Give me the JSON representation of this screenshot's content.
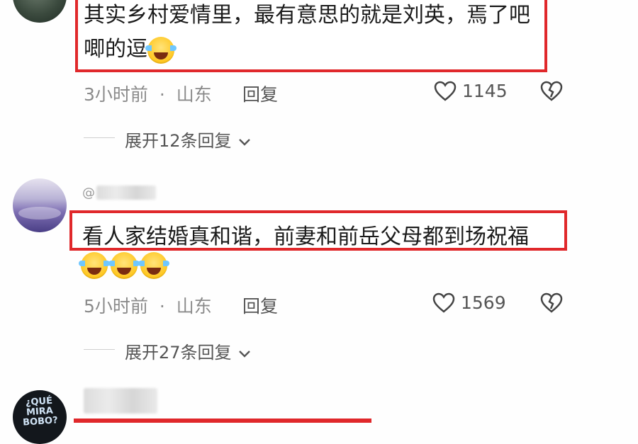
{
  "comments": [
    {
      "text_line1": "其实乡村爱情里，最有意思的就是刘英，焉了吧",
      "text_line2": "唧的逗",
      "time": "3小时前",
      "dot": "·",
      "location": "山东",
      "reply_label": "回复",
      "likes": "1145",
      "expand_label": "展开12条回复",
      "emojis": [
        "laugh-cry-emoji"
      ]
    },
    {
      "username_prefix": "@",
      "text_line1": "看人家结婚真和谐，前妻和前岳父母都到场祝福",
      "time": "5小时前",
      "dot": "·",
      "location": "山东",
      "reply_label": "回复",
      "likes": "1569",
      "expand_label": "展开27条回复",
      "emojis": [
        "laugh-cry-emoji",
        "laugh-cry-emoji",
        "laugh-cry-emoji"
      ]
    },
    {
      "avatar_text": "¿QUÉ MIRA BOBO?"
    }
  ],
  "icons": {
    "like": "heart-outline-icon",
    "dislike": "broken-heart-icon",
    "expand": "chevron-down-icon"
  },
  "colors": {
    "highlight": "#e0282b",
    "meta": "#8b8b8b"
  }
}
